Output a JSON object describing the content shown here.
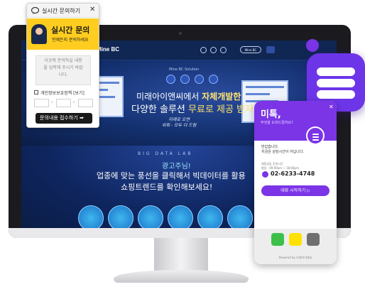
{
  "site": {
    "logo": "Mine BC",
    "cta": "Mine BC",
    "hero_tag": "Mine BC Solution",
    "hero_line1_a": "미래아이앤씨에서 ",
    "hero_line1_b": "자체개발한",
    "hero_line2_a": "다양한 솔루션 ",
    "hero_line2_b": "무료로 제공 받자!",
    "hero_sub": "미래로 오면\n쉬워 - 모두 다 드림",
    "bigdata": "BIG DATA LAB",
    "ad_label": "광고주님!",
    "lower_line1": "업종에 맞는 풍선을 클릭해서 빅데이터를 활용",
    "lower_line2": "쇼핑트렌드를 확인해보세요!"
  },
  "left_widget": {
    "title": "실시간 문의하기",
    "banner_title": "실시간 문의",
    "banner_sub": "언제든지 문의하세요",
    "textarea_placeholder": "이곳에 문의하실 내용\n을 입력해 주시기 바랍\n니다.",
    "privacy_label": "개인정보보호정책 [보기]",
    "submit_label": "문의내용 접수하기 ➡"
  },
  "right_widget": {
    "title": "미톡,",
    "subtitle": "무엇을 도와드릴까요?",
    "greeting": "반갑습니다.\n지금은 상담시간이 아닙니다.",
    "hours": "채팅상담 운영시간\n평일 : 09:00am ~ 18:00pm",
    "phone": "02-6233-4748",
    "start_label": "대화 시작하기 ▷",
    "powered": "Powered by 미래아이앤씨"
  },
  "colors": {
    "accent_purple": "#7b34e6",
    "banner_yellow": "#ffcd1f",
    "site_navy": "#0b1d46"
  }
}
